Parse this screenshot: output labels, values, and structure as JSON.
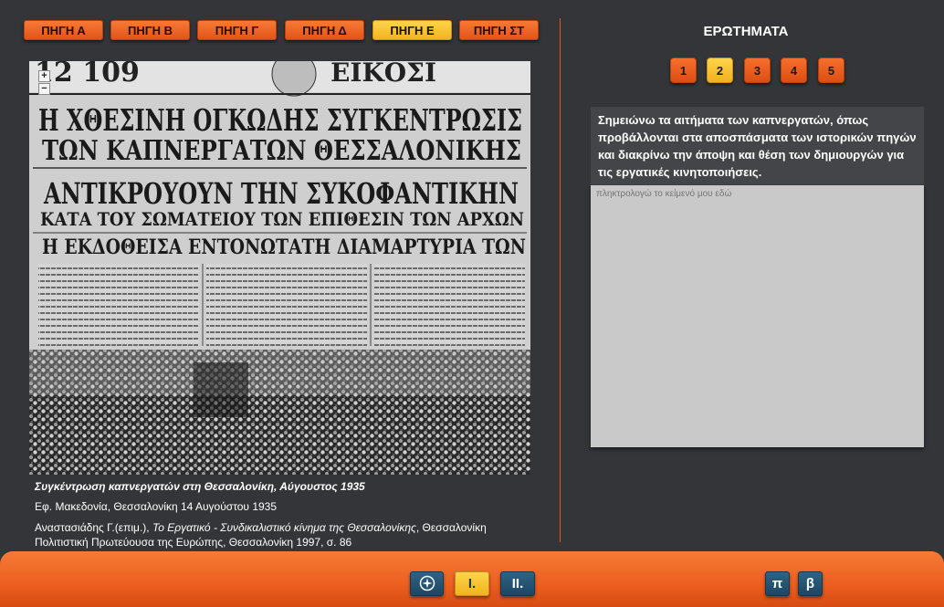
{
  "tabs": [
    {
      "label": "ΠΗΓΗ Α",
      "active": false
    },
    {
      "label": "ΠΗΓΗ Β",
      "active": false
    },
    {
      "label": "ΠΗΓΗ Γ",
      "active": false
    },
    {
      "label": "ΠΗΓΗ Δ",
      "active": false
    },
    {
      "label": "ΠΗΓΗ Ε",
      "active": true
    },
    {
      "label": "ΠΗΓΗ ΣΤ",
      "active": false
    }
  ],
  "document": {
    "headlines": [
      "Η ΧΘΕΣΙΝΗ ΟΓΚΩΔΗΣ ΣΥΓΚΕΝΤΡΩΣΙΣ",
      "ΤΩΝ ΚΑΠΝΕΡΓΑΤΩΝ ΘΕΣΣΑΛΟΝΙΚΗΣ",
      "ΑΝΤΙΚΡΟΥΟΥΝ ΤΗΝ ΣΥΚΟΦΑΝΤΙΚΗΝ",
      "ΚΑΤΑ ΤΟΥ ΣΩΜΑΤΕΙΟΥ ΤΩΝ ΕΠΙΘΕΣΙΝ ΤΩΝ ΑΡΧΩΝ",
      "Η ΕΚΔΟΘΕΙΣΑ ΕΝΤΟΝΩΤΑΤΗ ΔΙΑΜΑΡΤΥΡΙΑ ΤΩΝ"
    ],
    "zoom_in": "+",
    "zoom_out": "−"
  },
  "caption": {
    "title": "Συγκέντρωση καπνεργατών στη Θεσσαλονίκη, Αύγουστος 1935",
    "source": "Εφ. Μακεδονία, Θεσσαλονίκη 14 Αυγούστου 1935",
    "ref_author": "Αναστασιάδης Γ.(επιμ.), ",
    "ref_title": "Το Εργατικό - Συνδικαλιστικό κίνημα της Θεσσαλονίκης",
    "ref_rest": ", Θεσσαλονίκη Πολιτιστική Πρωτεύουσα της Ευρώπης, Θεσσαλονίκη 1997, σ. 86"
  },
  "questions": {
    "title": "ΕΡΩΤΗΜΑΤΑ",
    "numbers": [
      {
        "label": "1",
        "active": false
      },
      {
        "label": "2",
        "active": true
      },
      {
        "label": "3",
        "active": false
      },
      {
        "label": "4",
        "active": false
      },
      {
        "label": "5",
        "active": false
      }
    ],
    "prompt": "Σημειώνω τα αιτήματα των καπνεργατών, όπως προβάλλονται στα αποσπάσματα των ιστορικών πηγών και διακρίνω την άποψη και θέση των δημιουργών για τις εργατικές κινητοποιήσεις.",
    "answer_placeholder": "πληκτρολογώ το κείμενό μου εδώ"
  },
  "footer": {
    "compass_icon": "compass-icon",
    "btn_I": "I.",
    "btn_II": "II.",
    "btn_pi": "π",
    "btn_beta": "β"
  },
  "colors": {
    "orange": "#ec5f20",
    "gold": "#f3b321",
    "navy": "#1d4663",
    "background": "#333539"
  }
}
